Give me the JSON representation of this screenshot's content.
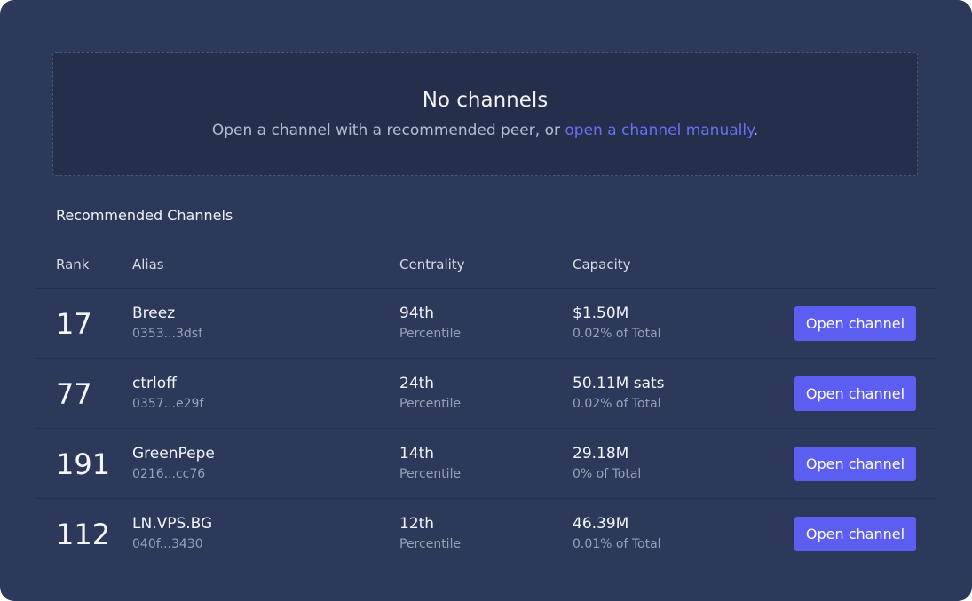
{
  "empty_state": {
    "title": "No channels",
    "subtitle_prefix": "Open a channel with a recommended peer, or ",
    "link_text": "open a channel manually",
    "subtitle_suffix": "."
  },
  "section_title": "Recommended Channels",
  "columns": {
    "rank": "Rank",
    "alias": "Alias",
    "centrality": "Centrality",
    "capacity": "Capacity"
  },
  "rows": [
    {
      "rank": "17",
      "alias": "Breez",
      "pubkey": "0353...3dsf",
      "centrality": "94th",
      "centrality_sub": "Percentile",
      "capacity": "$1.50M",
      "capacity_sub": "0.02% of Total",
      "action": "Open channel"
    },
    {
      "rank": "77",
      "alias": "ctrloff",
      "pubkey": "0357...e29f",
      "centrality": "24th",
      "centrality_sub": "Percentile",
      "capacity": "50.11M sats",
      "capacity_sub": "0.02% of Total",
      "action": "Open channel"
    },
    {
      "rank": "191",
      "alias": "GreenPepe",
      "pubkey": "0216...cc76",
      "centrality": "14th",
      "centrality_sub": "Percentile",
      "capacity": "29.18M",
      "capacity_sub": "0% of Total",
      "action": "Open channel"
    },
    {
      "rank": "112",
      "alias": "LN.VPS.BG",
      "pubkey": "040f...3430",
      "centrality": "12th",
      "centrality_sub": "Percentile",
      "capacity": "46.39M",
      "capacity_sub": "0.01% of Total",
      "action": "Open channel"
    }
  ],
  "colors": {
    "panel_bg": "#2d395a",
    "empty_bg": "#252f4b",
    "accent": "#5b5ef1",
    "link": "#6b6ff5"
  }
}
